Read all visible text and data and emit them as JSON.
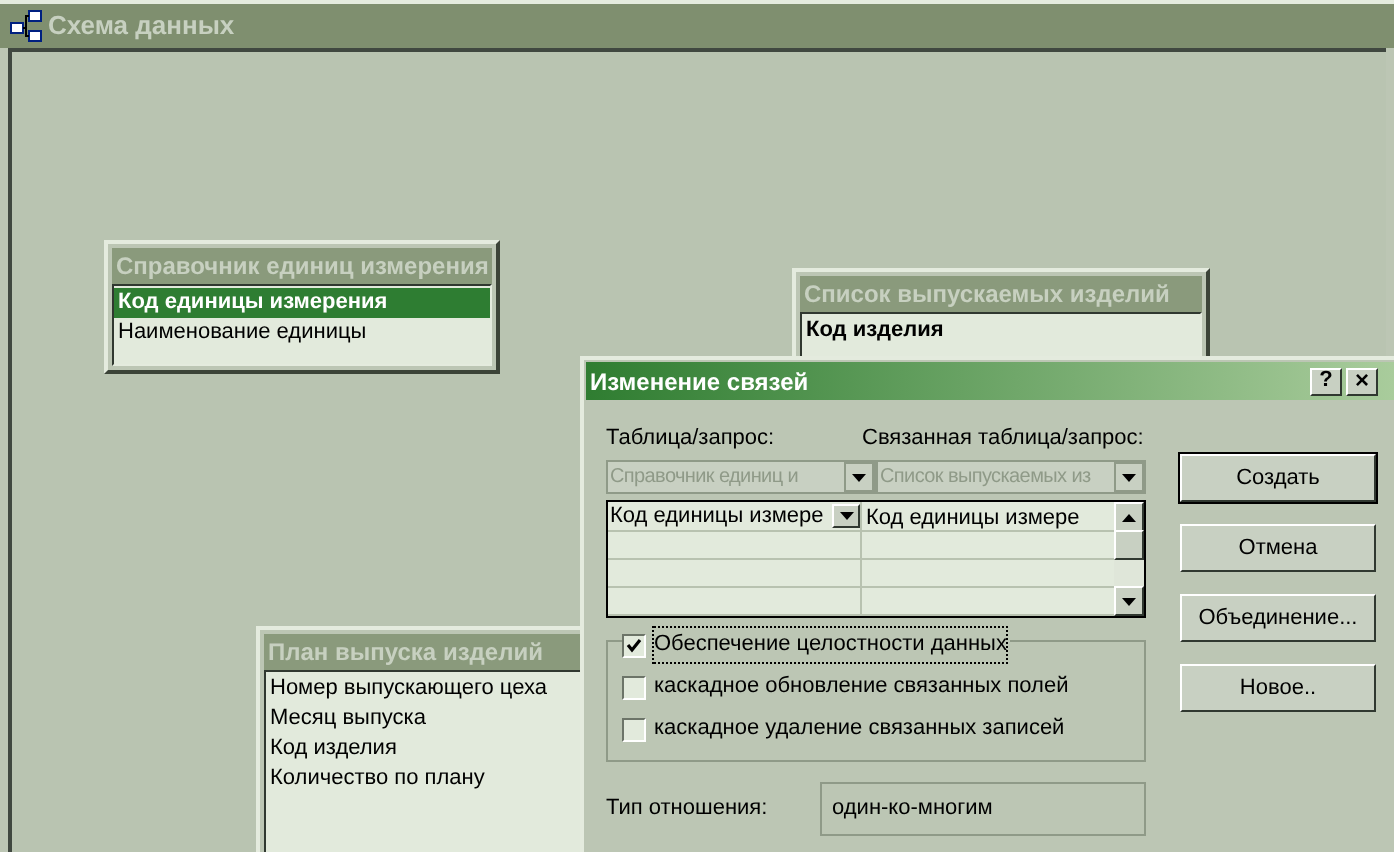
{
  "window": {
    "title": "Схема данных"
  },
  "tables": [
    {
      "title": "Справочник единиц измерения",
      "fields": [
        {
          "name": "Код единицы измерения",
          "key": true,
          "selected": true
        },
        {
          "name": "Наименование единицы",
          "key": false,
          "selected": false
        }
      ]
    },
    {
      "title": "Список выпускаемых изделий",
      "fields": [
        {
          "name": "Код изделия",
          "key": true,
          "selected": false
        }
      ]
    },
    {
      "title": "План выпуска изделий",
      "fields": [
        {
          "name": "Номер выпускающего цеха",
          "key": false,
          "selected": false
        },
        {
          "name": "Месяц выпуска",
          "key": false,
          "selected": false
        },
        {
          "name": "Код изделия",
          "key": false,
          "selected": false
        },
        {
          "name": "Количество по плану",
          "key": false,
          "selected": false
        }
      ]
    }
  ],
  "dialog": {
    "title": "Изменение связей",
    "help": "?",
    "close": "×",
    "table_label": "Таблица/запрос:",
    "related_label": "Связанная таблица/запрос:",
    "table_combo": {
      "value": "Справочник единиц и",
      "disabled": true
    },
    "related_combo": {
      "value": "Список выпускаемых из",
      "disabled": true
    },
    "grid_rows": [
      [
        "Код единицы измере",
        "Код единицы измере"
      ],
      [
        "",
        ""
      ],
      [
        "",
        ""
      ],
      [
        "",
        ""
      ]
    ],
    "options": [
      {
        "label": "Обеспечение целостности данных",
        "checked": true,
        "focused": true
      },
      {
        "label": "каскадное обновление связанных полей",
        "checked": false,
        "focused": false
      },
      {
        "label": "каскадное удаление связанных записей",
        "checked": false,
        "focused": false
      }
    ],
    "type_label": "Тип отношения:",
    "type_value": "один-ко-многим",
    "buttons": [
      {
        "label": "Создать",
        "default": true
      },
      {
        "label": "Отмена",
        "default": false
      },
      {
        "label": "Объединение...",
        "default": false
      },
      {
        "label": "Новое..",
        "default": false
      }
    ]
  }
}
